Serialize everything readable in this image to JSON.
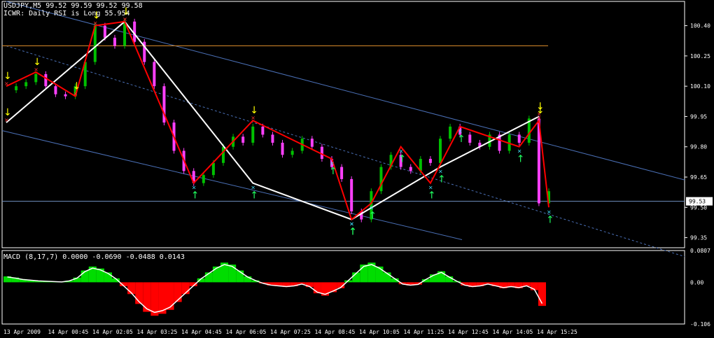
{
  "header": {
    "symbol_line": "USDJPY,M5  99.52 99.59 99.52 99.58",
    "indicator_line": "ICWR: Daily RSI is Long 55.954"
  },
  "macd_header": "MACD (8,17,7) 0.0000 -0.0690 -0.0488 0.0143",
  "colors": {
    "background": "#000000",
    "grid_frame": "#ffffff",
    "bull_candle": "#00c000",
    "bear_candle": "#ff40ff",
    "zigzag_red": "#ff0000",
    "zigzag_white": "#ffffff",
    "channel_blue": "#4a6fb5",
    "orange_line": "#d88a2a",
    "up_arrow": "#20ff60",
    "down_arrow": "#ffff00",
    "x_marker_red": "#ff3030",
    "x_marker_cyan": "#40e0ff",
    "macd_pos": "#00dd00",
    "macd_neg": "#ff0000"
  },
  "chart_data": [
    {
      "type": "candlestick",
      "title": "USDJPY,M5",
      "ylim": [
        99.3,
        100.52
      ],
      "y_ticks": [
        "100.40",
        "100.25",
        "100.10",
        "99.95",
        "99.80",
        "99.65",
        "99.50",
        "99.35"
      ],
      "current_price_label": "99.53",
      "x_ticks": [
        "13 Apr 2009",
        "14 Apr 00:45",
        "14 Apr 02:05",
        "14 Apr 03:25",
        "14 Apr 04:45",
        "14 Apr 06:05",
        "14 Apr 07:25",
        "14 Apr 08:45",
        "14 Apr 10:05",
        "14 Apr 11:25",
        "14 Apr 12:45",
        "14 Apr 14:05",
        "14 Apr 15:25"
      ],
      "price_path": [
        100.08,
        100.1,
        100.12,
        100.16,
        100.1,
        100.06,
        100.05,
        100.1,
        100.22,
        100.4,
        100.34,
        100.3,
        100.42,
        100.32,
        100.22,
        100.1,
        99.92,
        99.78,
        99.68,
        99.62,
        99.66,
        99.72,
        99.8,
        99.85,
        99.82,
        99.9,
        99.86,
        99.82,
        99.76,
        99.78,
        99.84,
        99.8,
        99.74,
        99.7,
        99.64,
        99.48,
        99.44,
        99.58,
        99.7,
        99.76,
        99.7,
        99.68,
        99.74,
        99.72,
        99.84,
        99.9,
        99.86,
        99.82,
        99.8,
        99.86,
        99.78,
        99.86,
        99.82,
        99.94,
        99.52,
        99.58
      ],
      "zigzag_red": [
        [
          0,
          100.1
        ],
        [
          3,
          100.17
        ],
        [
          7,
          100.05
        ],
        [
          9,
          100.4
        ],
        [
          12,
          100.42
        ],
        [
          19,
          99.62
        ],
        [
          25,
          99.93
        ],
        [
          33,
          99.74
        ],
        [
          35,
          99.44
        ],
        [
          37,
          99.52
        ],
        [
          40,
          99.8
        ],
        [
          43,
          99.62
        ],
        [
          46,
          99.9
        ],
        [
          52,
          99.8
        ],
        [
          54,
          99.93
        ],
        [
          55,
          99.5
        ]
      ],
      "zigzag_white": [
        [
          0,
          99.92
        ],
        [
          12,
          100.42
        ],
        [
          25,
          99.62
        ],
        [
          35,
          99.44
        ],
        [
          44,
          99.7
        ],
        [
          54,
          99.95
        ]
      ],
      "channel_upper": [
        [
          0,
          100.52
        ],
        [
          56,
          99.8
        ]
      ],
      "channel_mid": [
        [
          0,
          100.3
        ],
        [
          56,
          99.45
        ]
      ],
      "channel_lower": [
        [
          0,
          99.88
        ],
        [
          40,
          99.34
        ]
      ],
      "orange_level": 100.3,
      "horizontal_level": 99.53,
      "down_arrows_at": [
        3,
        7,
        12,
        24,
        29,
        37,
        48,
        55
      ],
      "up_arrows_at": [
        1,
        6,
        20,
        38,
        49,
        60
      ],
      "series": [
        {
          "values": [
            100.08,
            100.1,
            100.12,
            100.16,
            100.1,
            100.06,
            100.05,
            100.1,
            100.22,
            100.4,
            100.34,
            100.3,
            100.42,
            100.32,
            100.22,
            100.1,
            99.92,
            99.78,
            99.68,
            99.62,
            99.66,
            99.72,
            99.8,
            99.85,
            99.82,
            99.9,
            99.86,
            99.82,
            99.76,
            99.78,
            99.84,
            99.8,
            99.74,
            99.7,
            99.64,
            99.48,
            99.44,
            99.58,
            99.7,
            99.76,
            99.7,
            99.68,
            99.74,
            99.72,
            99.84,
            99.9,
            99.86,
            99.82,
            99.8,
            99.86,
            99.78,
            99.86,
            99.82,
            99.94,
            99.52,
            99.58
          ]
        }
      ]
    },
    {
      "type": "bar",
      "title": "MACD (8,17,7)",
      "ylim": [
        -0.106,
        0.0807
      ],
      "y_ticks": [
        "0.0807",
        "0.00",
        "-0.106"
      ],
      "values": [
        0.015,
        0.012,
        0.008,
        0.006,
        0.004,
        0.003,
        0.002,
        0.001,
        0.004,
        0.012,
        0.03,
        0.04,
        0.035,
        0.025,
        0.01,
        -0.01,
        -0.03,
        -0.055,
        -0.075,
        -0.085,
        -0.08,
        -0.07,
        -0.05,
        -0.03,
        -0.01,
        0.01,
        0.025,
        0.04,
        0.05,
        0.045,
        0.03,
        0.015,
        0.005,
        -0.003,
        -0.008,
        -0.01,
        -0.012,
        -0.01,
        -0.005,
        -0.012,
        -0.028,
        -0.034,
        -0.025,
        -0.015,
        0.005,
        0.025,
        0.045,
        0.05,
        0.04,
        0.025,
        0.01,
        -0.005,
        -0.008,
        -0.006,
        0.008,
        0.02,
        0.028,
        0.015,
        0.003,
        -0.008,
        -0.012,
        -0.01,
        -0.005,
        -0.01,
        -0.015,
        -0.012,
        -0.015,
        -0.01,
        -0.02,
        -0.06
      ]
    }
  ]
}
